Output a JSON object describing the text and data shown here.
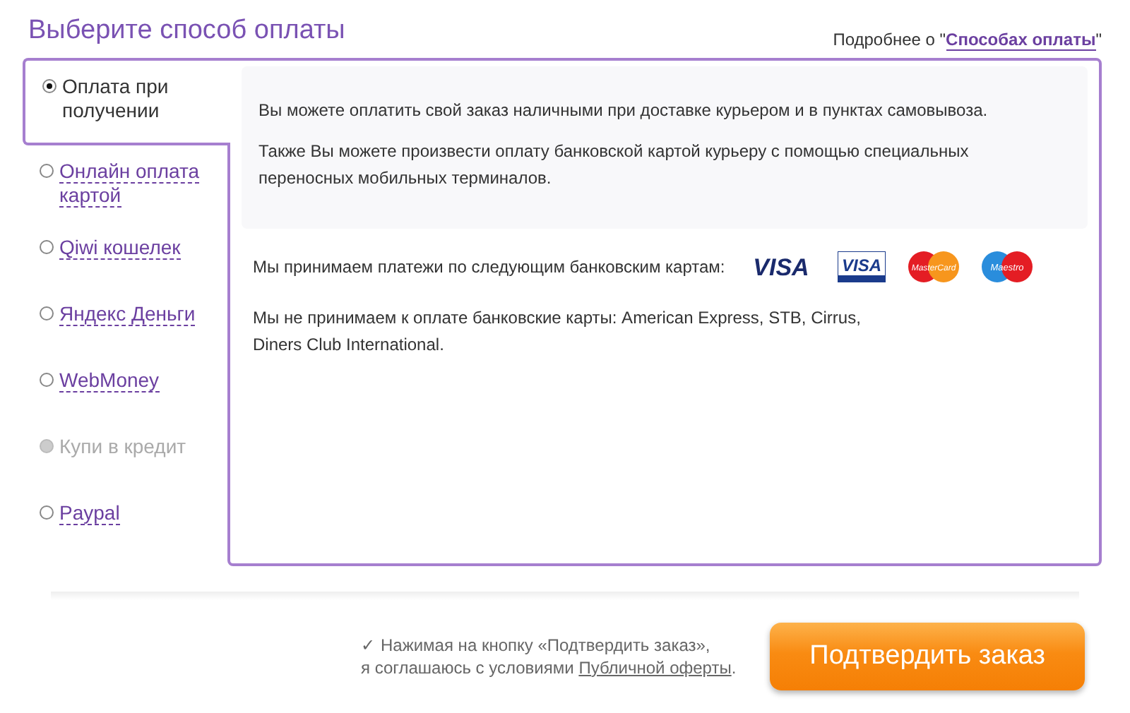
{
  "title": "Выберите способ оплаты",
  "more": {
    "prefix": "Подробнее о \"",
    "link": "Способах оплаты",
    "suffix": "\""
  },
  "methods": [
    {
      "label": "Оплата при получении",
      "selected": true,
      "disabled": false
    },
    {
      "label": "Онлайн оплата картой",
      "selected": false,
      "disabled": false
    },
    {
      "label": "Qiwi кошелек",
      "selected": false,
      "disabled": false
    },
    {
      "label": "Яндекс Деньги",
      "selected": false,
      "disabled": false
    },
    {
      "label": "WebMoney",
      "selected": false,
      "disabled": false
    },
    {
      "label": "Купи в кредит",
      "selected": false,
      "disabled": true
    },
    {
      "label": "Paypal",
      "selected": false,
      "disabled": false
    }
  ],
  "info": [
    "Вы можете оплатить свой заказ наличными при доставке курьером и в пунктах самовывоза.",
    "Также Вы можете произвести оплату банковской картой курьеру с помощью специальных переносных мобильных терминалов."
  ],
  "cards_text": "Мы принимаем платежи по следующим банковским картам:",
  "cards": [
    {
      "kind": "visa",
      "label": "VISA"
    },
    {
      "kind": "visa-electron",
      "label": "VISA"
    },
    {
      "kind": "mastercard",
      "label": "MasterCard"
    },
    {
      "kind": "maestro",
      "label": "Maestro"
    }
  ],
  "not_accepted": "Мы не принимаем к оплате банковские карты: American Express, STB, Cirrus, Diners Club International.",
  "agreement": {
    "check": "✓",
    "line1": "Нажимая на кнопку «Подтвердить заказ»,",
    "line2": "я соглашаюсь с условиями",
    "link": "Публичной оферты",
    "end": "."
  },
  "confirm": "Подтвердить заказ"
}
